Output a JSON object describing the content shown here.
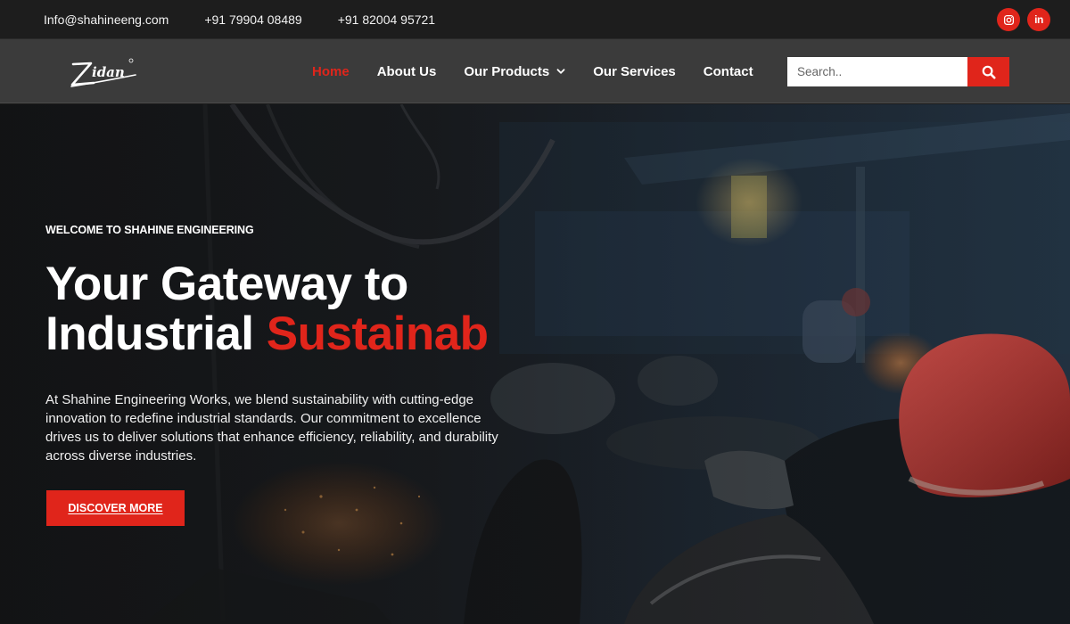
{
  "topbar": {
    "email": "Info@shahineeng.com",
    "phone_1": "+91 79904 08489",
    "phone_2": "+91 82004 95721",
    "socials": [
      {
        "name": "instagram",
        "icon": "instagram-icon"
      },
      {
        "name": "linkedin",
        "icon": "linkedin-icon",
        "glyph": "in"
      }
    ]
  },
  "header": {
    "logo_text": "Zidan",
    "nav": [
      {
        "label": "Home",
        "active": true
      },
      {
        "label": "About Us",
        "active": false
      },
      {
        "label": "Our Products",
        "active": false,
        "has_dropdown": true
      },
      {
        "label": "Our Services",
        "active": false
      },
      {
        "label": "Contact",
        "active": false
      }
    ],
    "search": {
      "placeholder": "Search..",
      "button_icon": "search-icon"
    }
  },
  "hero": {
    "eyebrow": "WELCOME TO SHAHINE ENGINEERING",
    "headline_line1": "Your Gateway to",
    "headline_line2_prefix": "Industrial ",
    "headline_line2_accent": "Sustainable",
    "intro": "At Shahine Engineering Works, we blend sustainability with cutting-edge innovation to redefine industrial standards. Our commitment to excellence drives us to deliver solutions that enhance efficiency, reliability, and durability across diverse industries.",
    "cta_label": "DISCOVER MORE"
  },
  "colors": {
    "accent": "#e0251b",
    "topbar_bg": "#1d1d1d",
    "navbar_bg": "#3b3b3b"
  }
}
